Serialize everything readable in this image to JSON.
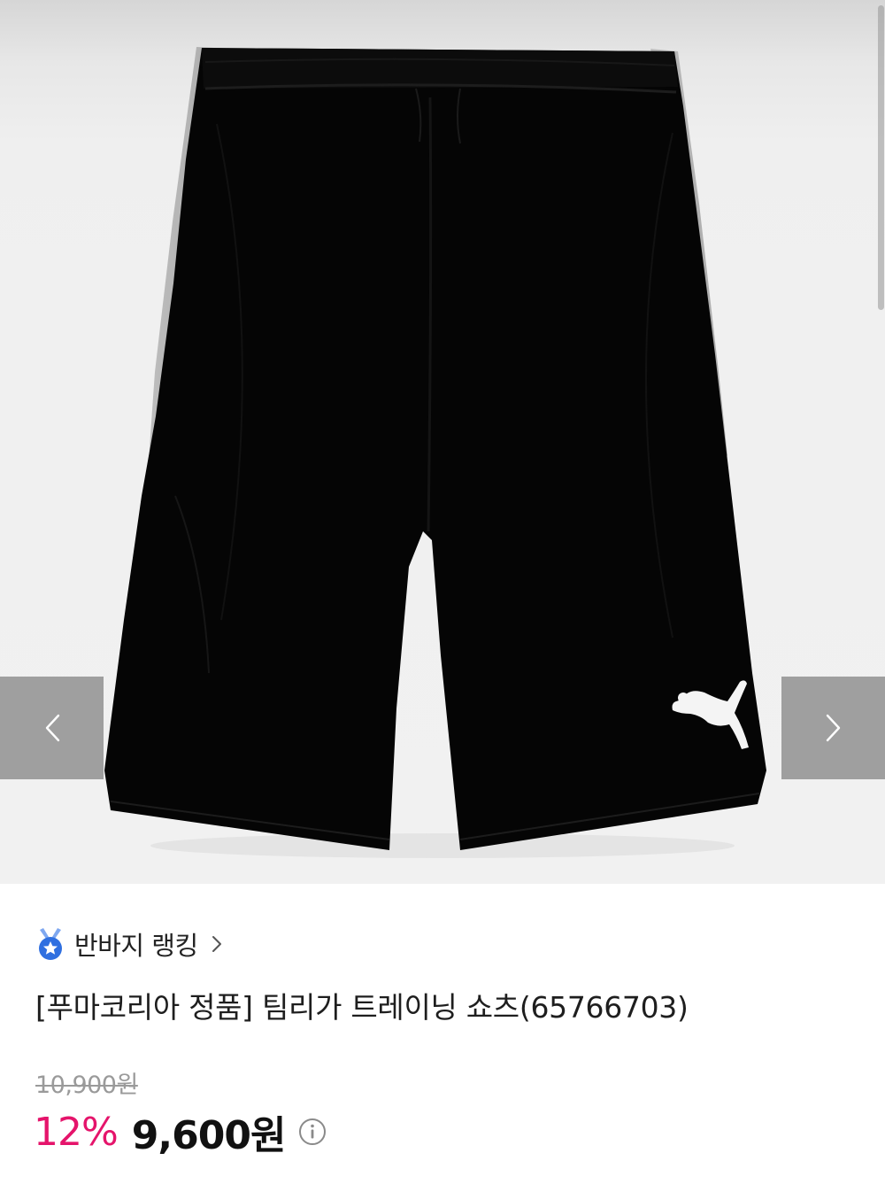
{
  "gallery": {
    "image_alt": "black puma training shorts with grey side stripes",
    "prev_icon": "chevron-left-icon",
    "next_icon": "chevron-right-icon"
  },
  "ranking": {
    "icon": "medal-icon",
    "label": "반바지 랭킹",
    "chevron": "›"
  },
  "product": {
    "title": "[푸마코리아 정품] 팀리가 트레이닝 쇼츠(65766703)"
  },
  "price": {
    "original": "10,900원",
    "discount_rate": "12%",
    "sale": "9,600원",
    "info_icon": "info-icon"
  },
  "colors": {
    "accent_discount": "#e5146b",
    "medal_blue": "#2f6fe0",
    "medal_ribbon": "#7fa8f0"
  }
}
